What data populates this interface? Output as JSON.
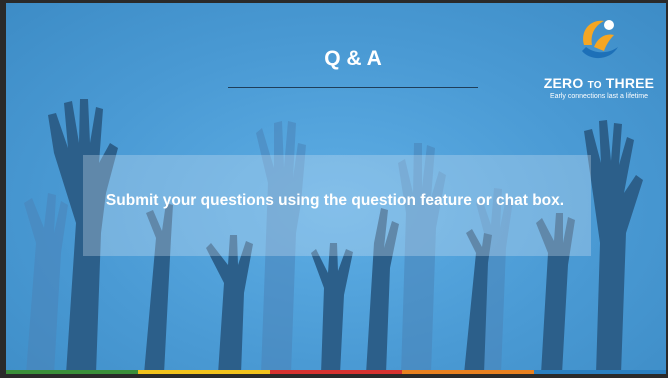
{
  "slide": {
    "title": "Q & A",
    "question_prompt": "Submit your questions using the question feature or chat box."
  },
  "logo": {
    "brand_zero": "ZERO",
    "brand_to": "TO",
    "brand_three": "THREE",
    "tagline": "Early connections last a lifetime"
  },
  "colors": {
    "background": "#4a9ad4",
    "hands": "#2c5f8a",
    "logo_orange": "#f5a623",
    "logo_blue": "#1d70b8",
    "bar": [
      "#3a8f3a",
      "#f2c21b",
      "#d6322f",
      "#e8801f",
      "#2a7fc0"
    ]
  }
}
